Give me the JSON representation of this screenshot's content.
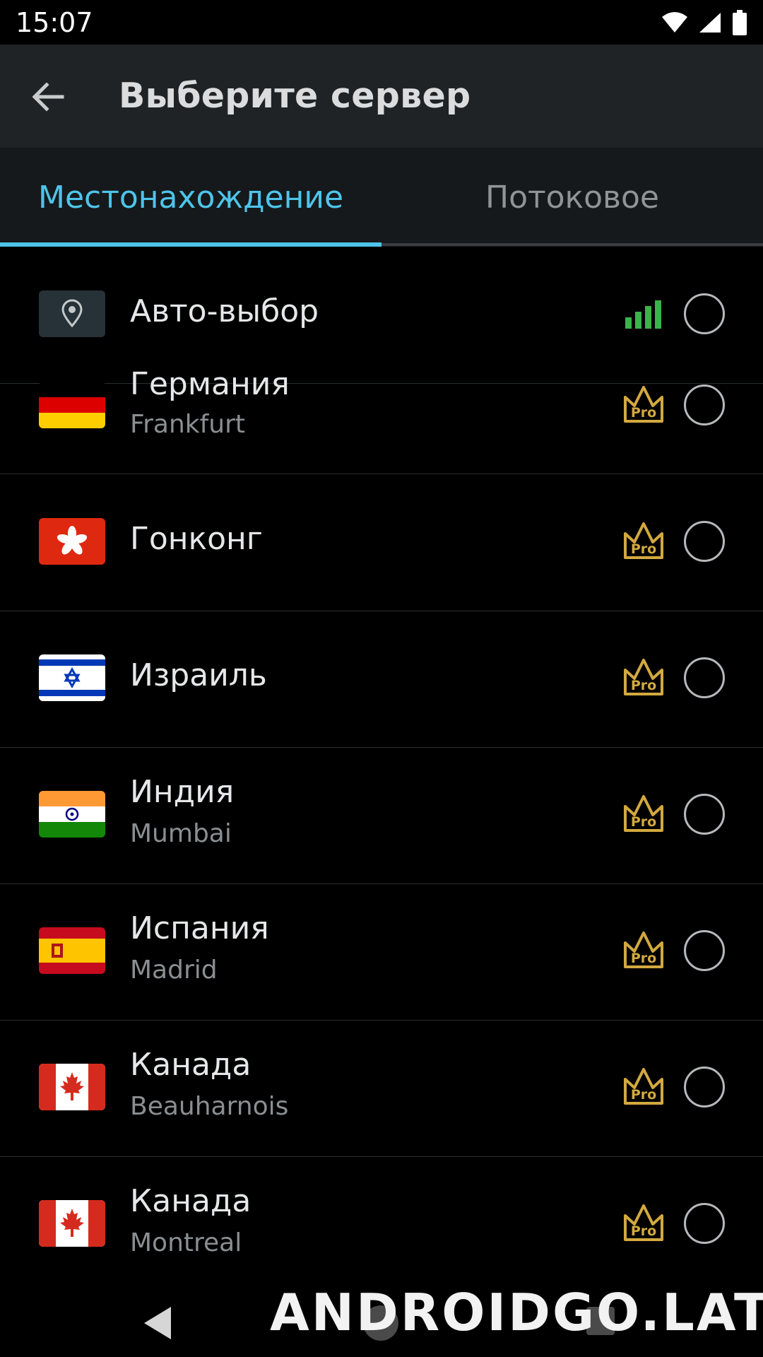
{
  "status_bar": {
    "time": "15:07"
  },
  "header": {
    "title": "Выберите сервер"
  },
  "tabs": [
    {
      "label": "Местонахождение",
      "active": true
    },
    {
      "label": "Потоковое",
      "active": false
    }
  ],
  "servers": [
    {
      "title": "Авто-выбор",
      "icon": "location-pin-icon",
      "status": "signal-icon"
    },
    {
      "title": "Германия",
      "subtitle": "Frankfurt",
      "flag": "germany",
      "badge": "Pro"
    },
    {
      "title": "Гонконг",
      "flag": "hong-kong",
      "badge": "Pro"
    },
    {
      "title": "Израиль",
      "flag": "israel",
      "badge": "Pro"
    },
    {
      "title": "Индия",
      "subtitle": "Mumbai",
      "flag": "india",
      "badge": "Pro"
    },
    {
      "title": "Испания",
      "subtitle": "Madrid",
      "flag": "spain",
      "badge": "Pro"
    },
    {
      "title": "Канада",
      "subtitle": "Beauharnois",
      "flag": "canada",
      "badge": "Pro"
    },
    {
      "title": "Канада",
      "subtitle": "Montreal",
      "flag": "canada",
      "badge": "Pro"
    }
  ],
  "watermark": "ANDROIDGO.LAT",
  "colors": {
    "accent": "#4ec4ea",
    "pro_gold": "#d3a93f",
    "signal_green": "#3ab34a"
  }
}
